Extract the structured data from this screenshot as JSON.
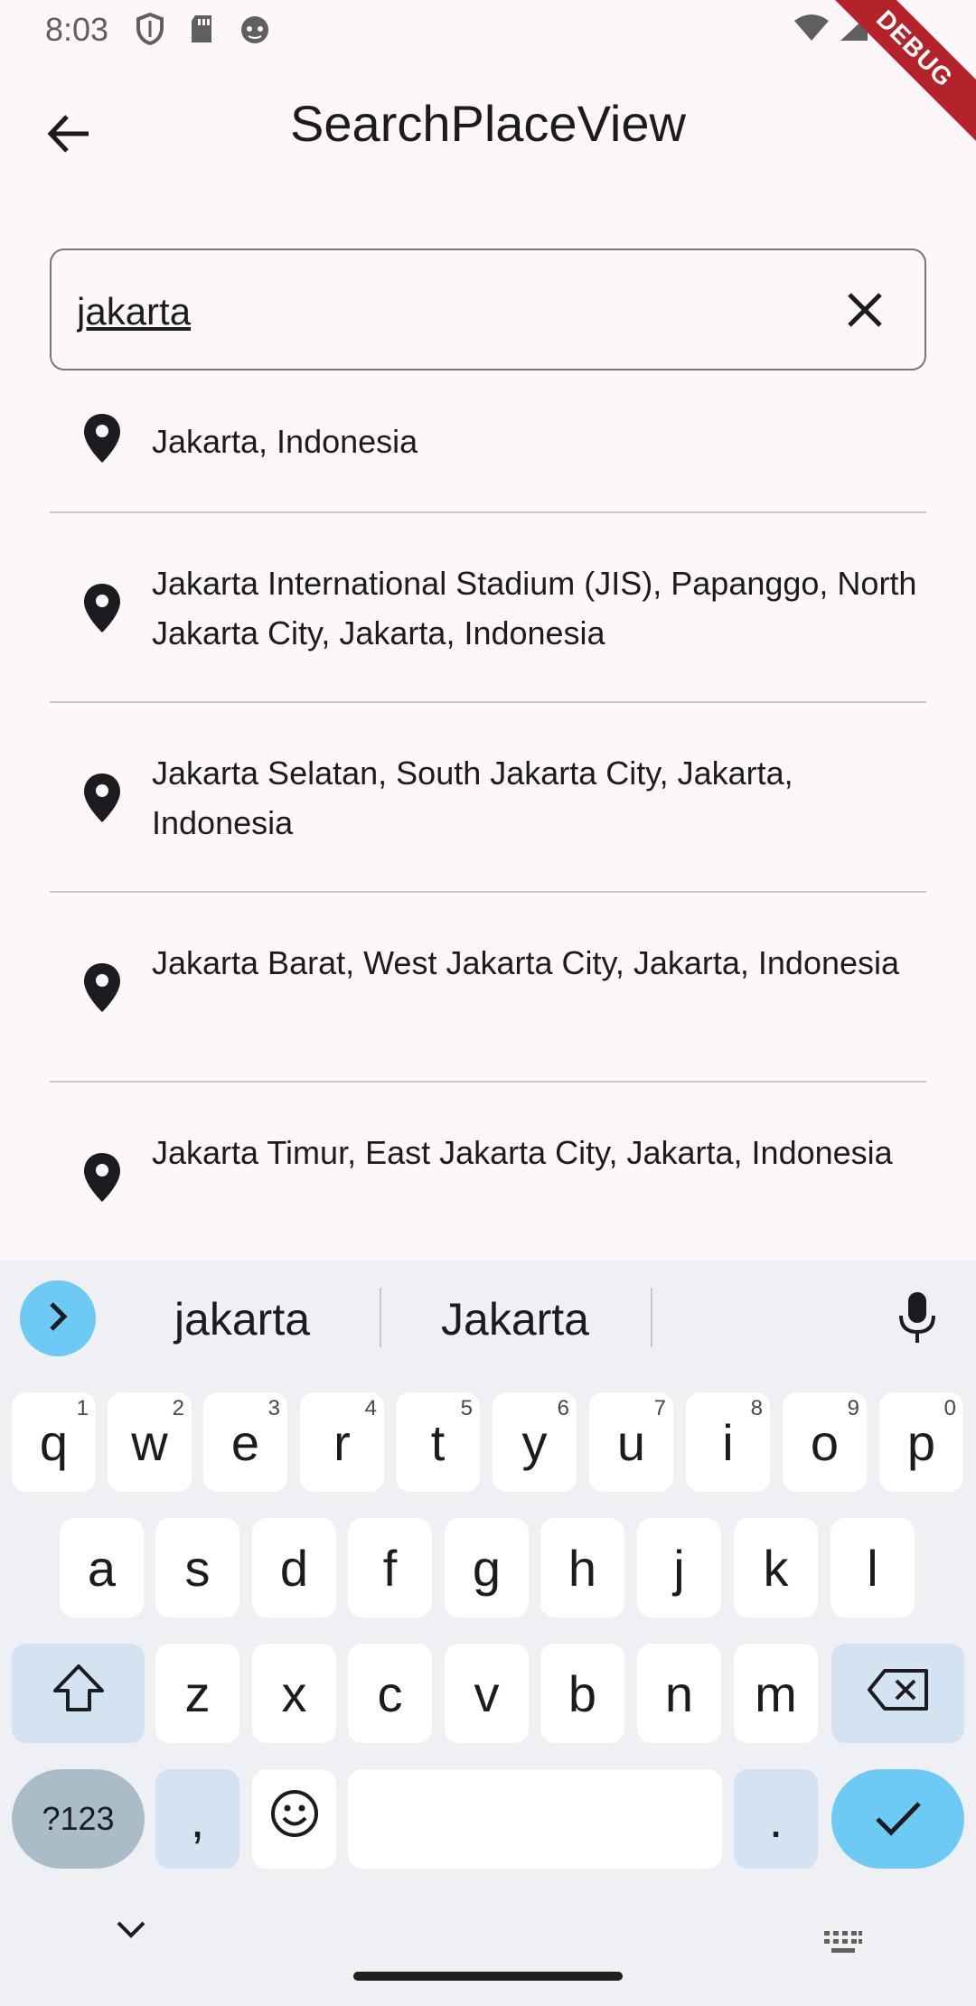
{
  "status_bar": {
    "time": "8:03",
    "left_icons": [
      "shield-icon",
      "sd-card-icon",
      "android-debug-icon"
    ],
    "right_icons": [
      "wifi-icon",
      "signal-icon",
      "battery-icon"
    ]
  },
  "debug_banner": "DEBUG",
  "app_bar": {
    "title": "SearchPlaceView",
    "back_icon": "arrow-back-icon"
  },
  "search": {
    "value": "jakarta",
    "clear_icon": "close-icon"
  },
  "results": [
    {
      "label": "Jakarta, Indonesia",
      "icon": "location-pin-icon"
    },
    {
      "label": "Jakarta International Stadium (JIS), Papanggo, North Jakarta City, Jakarta, Indonesia",
      "icon": "location-pin-icon"
    },
    {
      "label": "Jakarta Selatan, South Jakarta City, Jakarta, Indonesia",
      "icon": "location-pin-icon"
    },
    {
      "label": "Jakarta Barat, West Jakarta City, Jakarta, Indonesia",
      "icon": "location-pin-icon"
    },
    {
      "label": "Jakarta Timur, East Jakarta City, Jakarta, Indonesia",
      "icon": "location-pin-icon"
    }
  ],
  "keyboard": {
    "suggestions": [
      "jakarta",
      "Jakarta"
    ],
    "row1": [
      {
        "key": "q",
        "hint": "1"
      },
      {
        "key": "w",
        "hint": "2"
      },
      {
        "key": "e",
        "hint": "3"
      },
      {
        "key": "r",
        "hint": "4"
      },
      {
        "key": "t",
        "hint": "5"
      },
      {
        "key": "y",
        "hint": "6"
      },
      {
        "key": "u",
        "hint": "7"
      },
      {
        "key": "i",
        "hint": "8"
      },
      {
        "key": "o",
        "hint": "9"
      },
      {
        "key": "p",
        "hint": "0"
      }
    ],
    "row2": [
      "a",
      "s",
      "d",
      "f",
      "g",
      "h",
      "j",
      "k",
      "l"
    ],
    "row3": [
      "z",
      "x",
      "c",
      "v",
      "b",
      "n",
      "m"
    ],
    "symbols_label": "?123",
    "comma_label": ",",
    "period_label": ".",
    "accent_color": "#6ccaf5",
    "modifier_color": "#d3e3f2"
  },
  "colors": {
    "background": "#fdf7fb",
    "divider": "#c9c5ca",
    "field_border": "#79747e"
  }
}
